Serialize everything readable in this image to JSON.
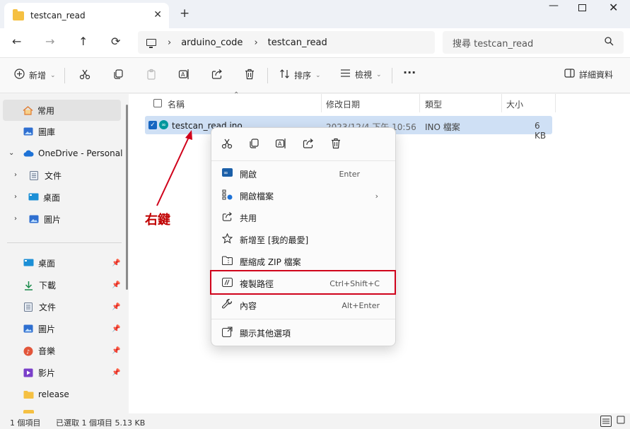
{
  "tab": {
    "title": "testcan_read",
    "close": "✕",
    "new_tab": "+"
  },
  "window": {
    "minimize": "—",
    "close": "✕"
  },
  "nav": {
    "back": "←",
    "forward": "→",
    "up": "↑",
    "refresh": "⟳"
  },
  "address": {
    "crumbs": [
      "arduino_code",
      "testcan_read"
    ],
    "sep": "›"
  },
  "search": {
    "placeholder": "搜尋 testcan_read"
  },
  "toolbar": {
    "new_label": "新增",
    "sort_label": "排序",
    "view_label": "檢視",
    "more": "···",
    "details_label": "詳細資料"
  },
  "sidebar": {
    "items": [
      {
        "label": "常用"
      },
      {
        "label": "圖庫"
      },
      {
        "label": "OneDrive - Personal"
      },
      {
        "label": "文件"
      },
      {
        "label": "桌面"
      },
      {
        "label": "圖片"
      }
    ],
    "pinned": [
      {
        "label": "桌面"
      },
      {
        "label": "下載"
      },
      {
        "label": "文件"
      },
      {
        "label": "圖片"
      },
      {
        "label": "音樂"
      },
      {
        "label": "影片"
      },
      {
        "label": "release"
      }
    ]
  },
  "columns": {
    "name": "名稱",
    "modified": "修改日期",
    "type": "類型",
    "size": "大小"
  },
  "file": {
    "name": "testcan_read.ino",
    "modified": "2023/12/4 下午 10:56",
    "type": "INO 檔案",
    "size": "6 KB"
  },
  "context_menu": {
    "items": [
      {
        "label": "開啟",
        "shortcut": "Enter"
      },
      {
        "label": "開啟檔案",
        "shortcut": ""
      },
      {
        "label": "共用",
        "shortcut": ""
      },
      {
        "label": "新增至 [我的最愛]",
        "shortcut": ""
      },
      {
        "label": "壓縮成 ZIP 檔案",
        "shortcut": ""
      },
      {
        "label": "複製路徑",
        "shortcut": "Ctrl+Shift+C"
      },
      {
        "label": "內容",
        "shortcut": "Alt+Enter"
      },
      {
        "label": "顯示其他選項",
        "shortcut": ""
      }
    ]
  },
  "annotation": {
    "label": "右鍵",
    "color": "#c00000",
    "highlight_color": "#d0021b"
  },
  "status": {
    "count": "1 個項目",
    "selected": "已選取 1 個項目  5.13 KB"
  },
  "colors": {
    "accent": "#1665c1",
    "selection": "#cfe0f5",
    "arduino": "#00979d",
    "folder": "#f5c042"
  }
}
